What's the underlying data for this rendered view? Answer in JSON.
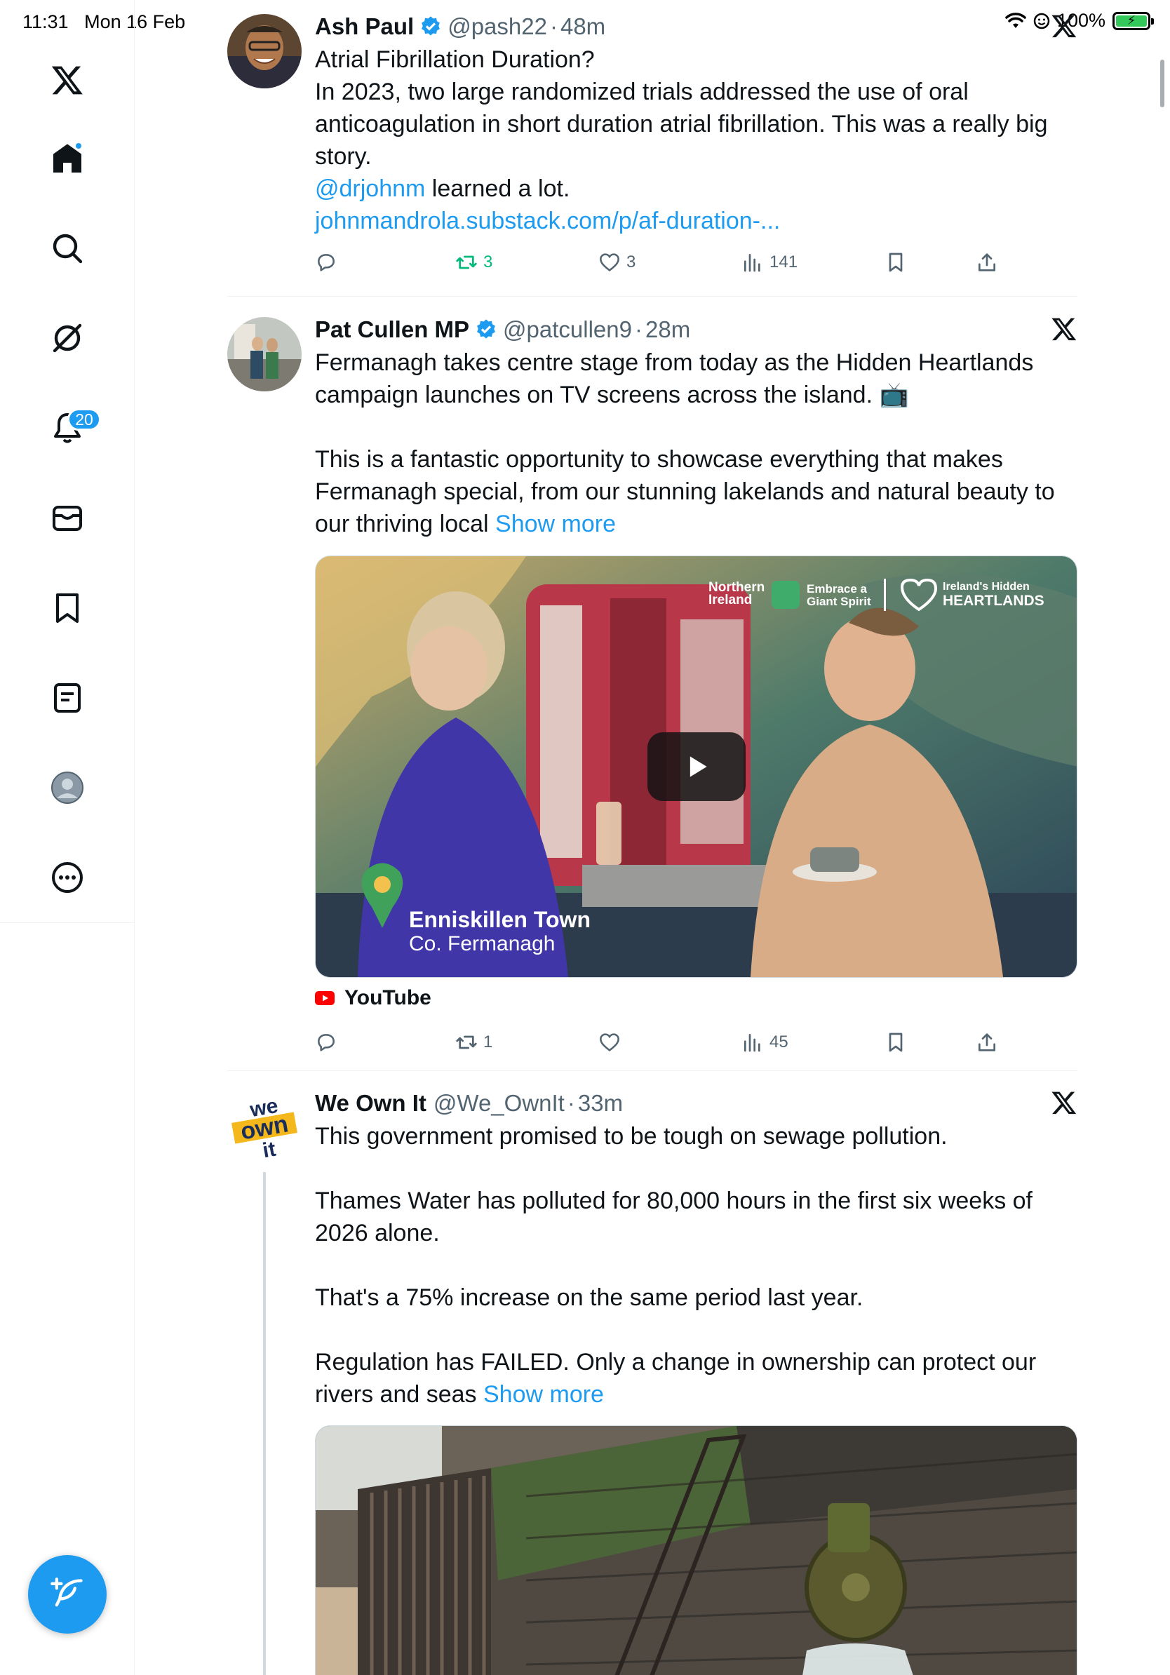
{
  "status_bar": {
    "time": "11:31",
    "date": "Mon 16 Feb",
    "battery": "100%"
  },
  "sidebar": {
    "notifications_badge": "20",
    "items": [
      "home",
      "search",
      "grok",
      "notifications",
      "messages",
      "bookmarks",
      "lists",
      "profile",
      "more"
    ]
  },
  "tweets": [
    {
      "name": "Ash Paul",
      "handle": "@pash22",
      "time": "48m",
      "lines": [
        "Atrial Fibrillation Duration?",
        "In 2023, two large randomized trials addressed the use of oral anticoagulation in short duration atrial fibrillation. This was a really big story."
      ],
      "mention": "@drjohnm",
      "mention_tail": " learned a lot.",
      "link": "johnmandrola.substack.com/p/af-duration-...",
      "retweets": "3",
      "likes": "3",
      "views": "141"
    },
    {
      "name": "Pat Cullen MP",
      "handle": "@patcullen9",
      "time": "28m",
      "p1": "Fermanagh takes centre stage from today as the Hidden Heartlands campaign launches on TV screens across the island. 📺",
      "p2": "This is a fantastic opportunity to showcase everything that makes Fermanagh special, from our stunning lakelands and natural beauty to our thriving local ",
      "show_more": "Show more",
      "video": {
        "brand_left": "Northern Ireland",
        "brand_mid": "Embrace a Giant Spirit",
        "brand_right_top": "Ireland's Hidden",
        "brand_right_bottom": "HEARTLANDS",
        "location_title": "Enniskillen Town",
        "location_sub": "Co. Fermanagh"
      },
      "source": "YouTube",
      "retweets": "1",
      "likes": "",
      "views": "45"
    },
    {
      "name": "We Own It",
      "handle": "@We_OwnIt",
      "time": "33m",
      "avatar_text": [
        "we",
        "own",
        "it"
      ],
      "p1": "This government promised to be tough on sewage pollution.",
      "p2": "Thames Water has polluted for 80,000 hours in the first six weeks of 2026 alone.",
      "p3": "That's a 75% increase on the same period last year.",
      "p4": "Regulation has FAILED. Only a change in ownership can protect our rivers and seas ",
      "show_more": "Show more"
    }
  ],
  "colors": {
    "accent": "#1d9bf0",
    "retweet": "#00ba7c",
    "muted": "#536471"
  }
}
